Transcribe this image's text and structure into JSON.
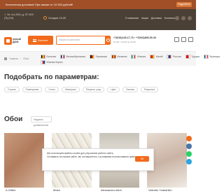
{
  "promo": {
    "text": "Бесплатная доставка! При заказе от 10 000 рублей!",
    "more": "Подробнее"
  },
  "utility": {
    "location": "Ул. 4-я ХХХ, д. 37 ХХХ (ТЦ ХХ)",
    "hours": "Сегодня: 10-20",
    "links": [
      "О компании",
      "Акции",
      "Доставка",
      "Контакты"
    ]
  },
  "header": {
    "logo_line1": "новый",
    "logo_line2": "ДОМ",
    "catalog": "Каталог",
    "search_placeholder": "Искать в каталоге",
    "phones": "+7(916)145-17-70 • +7(916)836-50-30",
    "phone_note": "Пн-Вс с 10:00 до 20:00"
  },
  "countries_row1": [
    {
      "name": "Бельгия",
      "c1": "#000000",
      "c2": "#fdda24",
      "c3": "#ef3340"
    },
    {
      "name": "Великобритания",
      "c1": "#012169",
      "c2": "#ffffff",
      "c3": "#c8102e"
    },
    {
      "name": "Германия",
      "c1": "#000000",
      "c2": "#dd0000",
      "c3": "#ffce00"
    },
    {
      "name": "Испания",
      "c1": "#aa151b",
      "c2": "#f1bf00",
      "c3": "#aa151b"
    },
    {
      "name": "Италия",
      "c1": "#009246",
      "c2": "#ffffff",
      "c3": "#ce2b37"
    },
    {
      "name": "Китай",
      "c1": "#de2910",
      "c2": "#de2910",
      "c3": "#ffde00"
    },
    {
      "name": "Россия",
      "c1": "#ffffff",
      "c2": "#0039a6",
      "c3": "#d52b1e"
    },
    {
      "name": "Турция",
      "c1": "#e30a17",
      "c2": "#e30a17",
      "c3": "#ffffff"
    },
    {
      "name": "Франция",
      "c1": "#0055a4",
      "c2": "#ffffff",
      "c3": "#ef4135"
    }
  ],
  "countries_row2": [
    {
      "name": "Южная Корея",
      "c1": "#ffffff",
      "c2": "#cd2e3a",
      "c3": "#0047a0"
    }
  ],
  "breadcrumbs": [
    "Главная",
    "Обои"
  ],
  "params_title": "Подобрать по параметрам:",
  "params_value": "Обои",
  "chips": [
    "Страна",
    "Помещение",
    "Стиль",
    "Материал",
    "Рисунок, узор",
    "Цвет",
    "Основа",
    "Покрытие"
  ],
  "page_title": "Обои",
  "sort_label": "Недавно добавленные",
  "cards": [
    "A.Giffori",
    "Moka",
    "Alessandro Allori",
    "Valentin Yudashkin"
  ],
  "cookie": {
    "line1": "Мы используем файлы cookie для улучшения работы сайта.",
    "line2": "Оставаясь на нашем сайте, вы соглашаетесь с условиями использования файлов cookie.",
    "ok": "ОК"
  },
  "side_colors": [
    "#f26a1b",
    "#4a76a8",
    "#25d366",
    "#2ca5e0"
  ]
}
